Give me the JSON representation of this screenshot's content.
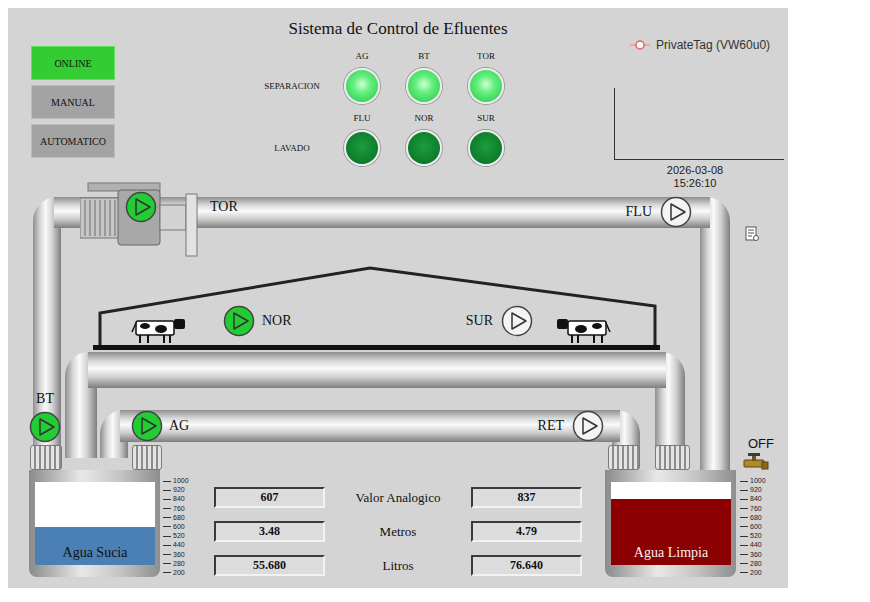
{
  "window": {
    "title": "Sistema de Control de Efluentes"
  },
  "modes": [
    {
      "label": "ONLINE",
      "selected": true
    },
    {
      "label": "MANUAL",
      "selected": false
    },
    {
      "label": "AUTOMATICO",
      "selected": false
    }
  ],
  "indicators": [
    {
      "label": "SEPARACION",
      "lamps": [
        {
          "label": "AG",
          "on": true
        },
        {
          "label": "BT",
          "on": true
        },
        {
          "label": "TOR",
          "on": true
        }
      ]
    },
    {
      "label": "LAVADO",
      "lamps": [
        {
          "label": "FLU",
          "on": false
        },
        {
          "label": "NOR",
          "on": false
        },
        {
          "label": "SUR",
          "on": false
        }
      ]
    }
  ],
  "chart": {
    "legend": "PrivateTag (VW60u0)",
    "date": "2026-03-08",
    "time": "15:26:10"
  },
  "pumps": [
    {
      "label": "TOR",
      "on": true
    },
    {
      "label": "FLU",
      "on": false
    },
    {
      "label": "NOR",
      "on": true
    },
    {
      "label": "SUR",
      "on": false
    },
    {
      "label": "BT",
      "on": true
    },
    {
      "label": "AG",
      "on": true
    },
    {
      "label": "RET",
      "on": false
    }
  ],
  "valve": {
    "label": "OFF"
  },
  "tanks": [
    {
      "name": "Agua Sucia",
      "level": 0.46,
      "color": "#4a80b4",
      "readings": [
        "607",
        "3.48",
        "55.680"
      ]
    },
    {
      "name": "Agua Limpia",
      "level": 0.8,
      "color": "#8b0000",
      "readings": [
        "837",
        "4.79",
        "76.640"
      ]
    }
  ],
  "scale": [
    "1000",
    "920",
    "840",
    "760",
    "680",
    "600",
    "520",
    "440",
    "360",
    "280",
    "200"
  ],
  "readouts": {
    "labels": [
      "Valor Analogico",
      "Metros",
      "Litros"
    ]
  }
}
